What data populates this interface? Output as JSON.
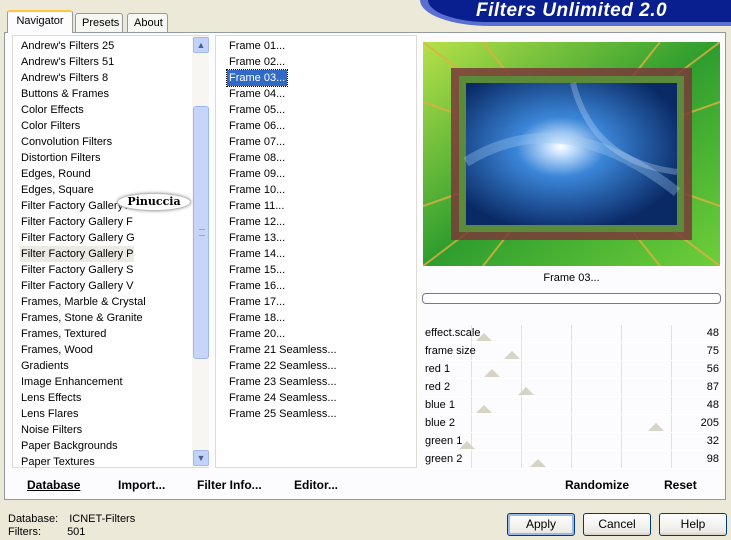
{
  "banner": {
    "title": "Filters Unlimited 2.0"
  },
  "tabs": [
    {
      "label": "Navigator"
    },
    {
      "label": "Presets"
    },
    {
      "label": "About"
    }
  ],
  "categories": {
    "items": [
      "Andrew's Filters 25",
      "Andrew's Filters 51",
      "Andrew's Filters 8",
      "Buttons & Frames",
      "Color Effects",
      "Color Filters",
      "Convolution Filters",
      "Distortion Filters",
      "Edges, Round",
      "Edges, Square",
      "Filter Factory Gallery A",
      "Filter Factory Gallery F",
      "Filter Factory Gallery G",
      "Filter Factory Gallery P",
      "Filter Factory Gallery S",
      "Filter Factory Gallery V",
      "Frames, Marble & Crystal",
      "Frames, Stone & Granite",
      "Frames, Textured",
      "Frames, Wood",
      "Gradients",
      "Image Enhancement",
      "Lens Effects",
      "Lens Flares",
      "Noise Filters",
      "Paper Backgrounds",
      "Paper Textures"
    ],
    "selected": "Filter Factory Gallery P"
  },
  "watermark": "Pinuccia",
  "frames": {
    "items": [
      "Frame 01...",
      "Frame 02...",
      "Frame 03...",
      "Frame 04...",
      "Frame 05...",
      "Frame 06...",
      "Frame 07...",
      "Frame 08...",
      "Frame 09...",
      "Frame 10...",
      "Frame 11...",
      "Frame 12...",
      "Frame 13...",
      "Frame 14...",
      "Frame 15...",
      "Frame 16...",
      "Frame 17...",
      "Frame 18...",
      "Frame 20...",
      "Frame 21 Seamless...",
      "Frame 22 Seamless...",
      "Frame 23 Seamless...",
      "Frame 24 Seamless...",
      "Frame 25 Seamless..."
    ],
    "selected": "Frame 03..."
  },
  "preview": {
    "label": "Frame 03..."
  },
  "sliders": [
    {
      "label": "effect.scale",
      "value": "48",
      "fraction": 0.19
    },
    {
      "label": "frame size",
      "value": "75",
      "fraction": 0.29
    },
    {
      "label": "red 1",
      "value": "56",
      "fraction": 0.22
    },
    {
      "label": "red 2",
      "value": "87",
      "fraction": 0.34
    },
    {
      "label": "blue 1",
      "value": "48",
      "fraction": 0.19
    },
    {
      "label": "blue 2",
      "value": "205",
      "fraction": 0.8
    },
    {
      "label": "green 1",
      "value": "32",
      "fraction": 0.13
    },
    {
      "label": "green 2",
      "value": "98",
      "fraction": 0.38
    }
  ],
  "actions": {
    "database": "Database",
    "import": "Import...",
    "filter_info": "Filter Info...",
    "editor": "Editor...",
    "randomize": "Randomize",
    "reset": "Reset"
  },
  "status": {
    "database_label": "Database:",
    "database_value": "ICNET-Filters",
    "filters_label": "Filters:",
    "filters_value": "501"
  },
  "buttons": {
    "apply": "Apply",
    "cancel": "Cancel",
    "help": "Help"
  },
  "colors": {
    "banner": "#0a1f8f",
    "selection": "#316ac5",
    "accent_tab": "#ffc83c"
  }
}
